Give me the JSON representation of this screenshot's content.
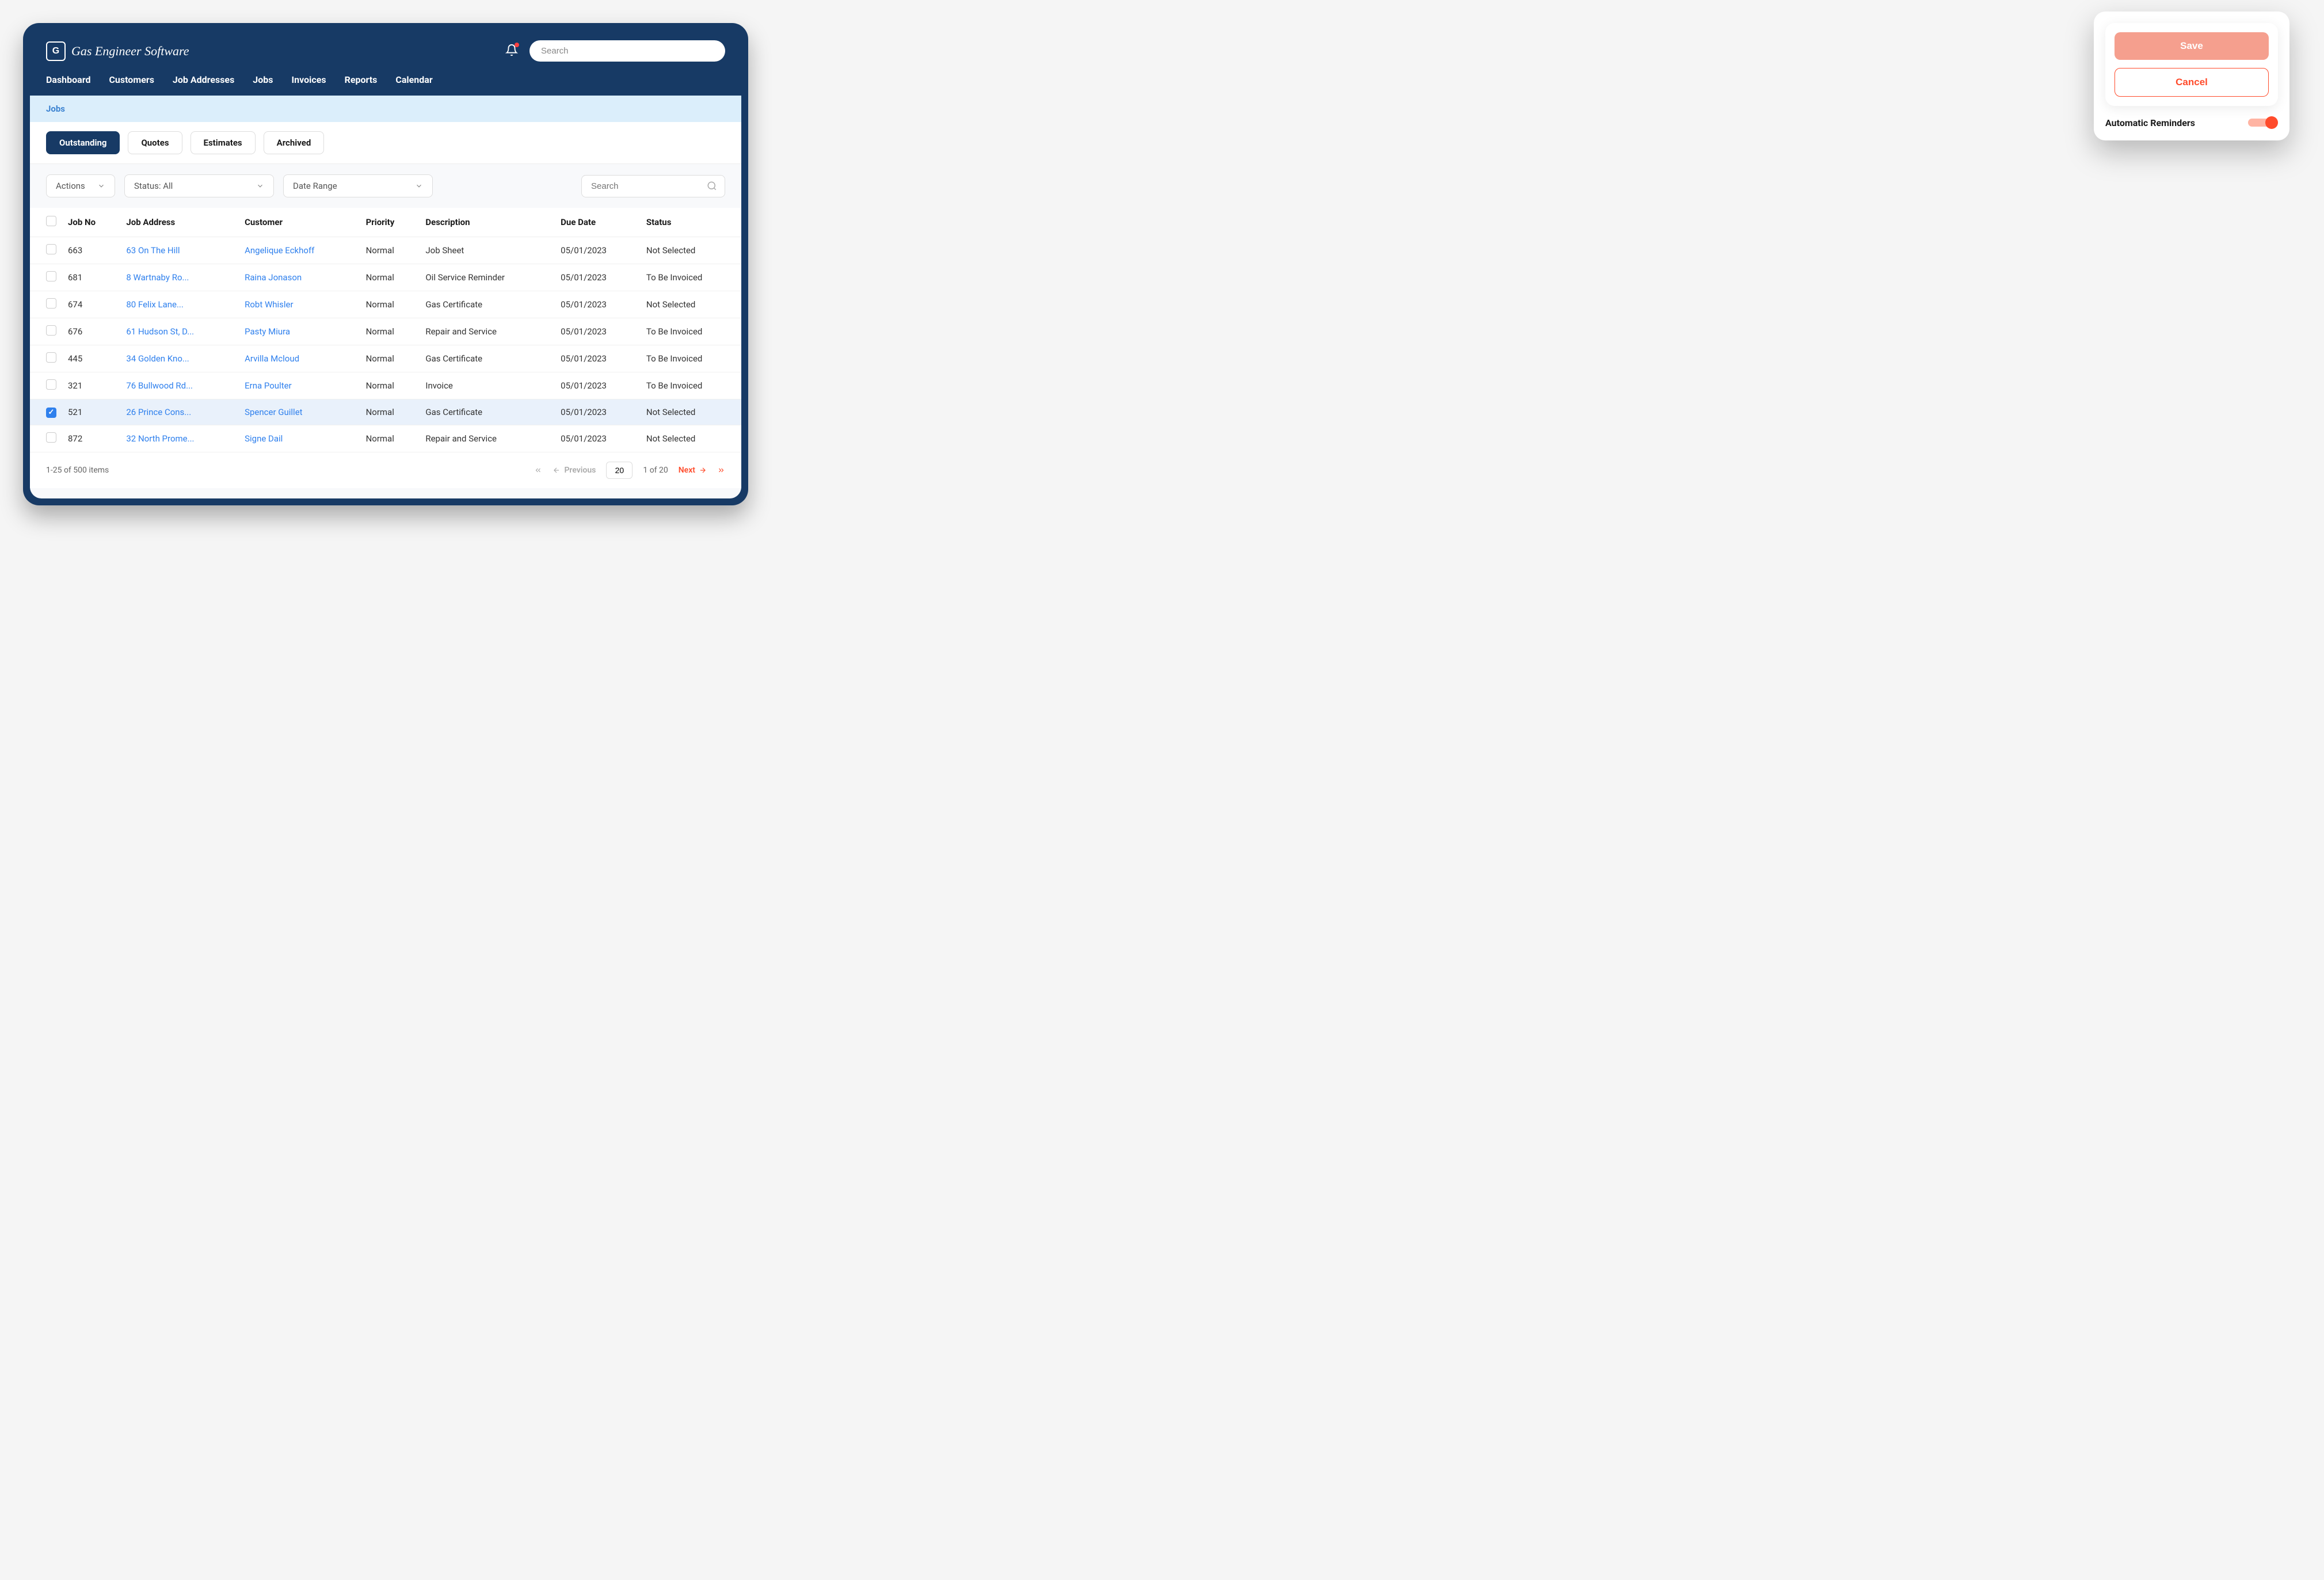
{
  "app": {
    "name": "Gas Engineer Software",
    "search_placeholder": "Search"
  },
  "nav": {
    "items": [
      "Dashboard",
      "Customers",
      "Job Addresses",
      "Jobs",
      "Invoices",
      "Reports",
      "Calendar"
    ]
  },
  "breadcrumb": "Jobs",
  "tabs": {
    "items": [
      "Outstanding",
      "Quotes",
      "Estimates",
      "Archived"
    ],
    "active_index": 0
  },
  "filters": {
    "actions_label": "Actions",
    "status_label": "Status: All",
    "date_range_label": "Date Range",
    "search_placeholder": "Search"
  },
  "table": {
    "headers": [
      "Job No",
      "Job Address",
      "Customer",
      "Priority",
      "Description",
      "Due Date",
      "Status"
    ],
    "rows": [
      {
        "checked": false,
        "job_no": "663",
        "address": "63 On The Hill",
        "customer": "Angelique Eckhoff",
        "priority": "Normal",
        "description": "Job Sheet",
        "due_date": "05/01/2023",
        "status": "Not Selected"
      },
      {
        "checked": false,
        "job_no": "681",
        "address": "8 Wartnaby Ro...",
        "customer": "Raina Jonason",
        "priority": "Normal",
        "description": "Oil Service Reminder",
        "due_date": "05/01/2023",
        "status": "To Be Invoiced"
      },
      {
        "checked": false,
        "job_no": "674",
        "address": "80 Felix Lane...",
        "customer": "Robt Whisler",
        "priority": "Normal",
        "description": "Gas Certificate",
        "due_date": "05/01/2023",
        "status": "Not Selected"
      },
      {
        "checked": false,
        "job_no": "676",
        "address": "61 Hudson St, D...",
        "customer": "Pasty Miura",
        "priority": "Normal",
        "description": "Repair and Service",
        "due_date": "05/01/2023",
        "status": "To Be Invoiced"
      },
      {
        "checked": false,
        "job_no": "445",
        "address": "34 Golden Kno...",
        "customer": "Arvilla Mcloud",
        "priority": "Normal",
        "description": "Gas Certificate",
        "due_date": "05/01/2023",
        "status": "To Be Invoiced"
      },
      {
        "checked": false,
        "job_no": "321",
        "address": "76 Bullwood Rd...",
        "customer": "Erna Poulter",
        "priority": "Normal",
        "description": "Invoice",
        "due_date": "05/01/2023",
        "status": "To Be Invoiced"
      },
      {
        "checked": true,
        "job_no": "521",
        "address": "26 Prince Cons...",
        "customer": "Spencer Guillet",
        "priority": "Normal",
        "description": "Gas Certificate",
        "due_date": "05/01/2023",
        "status": "Not Selected"
      },
      {
        "checked": false,
        "job_no": "872",
        "address": "32 North Prome...",
        "customer": "Signe Dail",
        "priority": "Normal",
        "description": "Repair and Service",
        "due_date": "05/01/2023",
        "status": "Not Selected"
      }
    ]
  },
  "pagination": {
    "summary": "1-25  of 500 items",
    "prev_label": "Previous",
    "next_label": "Next",
    "page_input": "20",
    "page_of": "1 of 20"
  },
  "overlay": {
    "save_label": "Save",
    "cancel_label": "Cancel",
    "reminders_label": "Automatic Reminders",
    "reminders_on": true
  }
}
